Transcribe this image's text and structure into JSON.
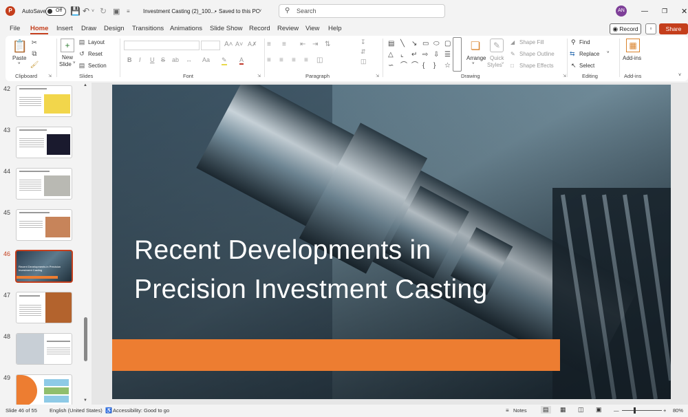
{
  "titlebar": {
    "app_logo": "P",
    "autosave_label": "AutoSave",
    "autosave_state": "Off",
    "doc_title": "Investment Casting (2)_100...",
    "save_state": "Saved to this PC",
    "search_placeholder": "Search",
    "avatar_initials": "AN"
  },
  "tabs": [
    "File",
    "Home",
    "Insert",
    "Draw",
    "Design",
    "Transitions",
    "Animations",
    "Slide Show",
    "Record",
    "Review",
    "View",
    "Help"
  ],
  "active_tab": "Home",
  "actions": {
    "record": "Record",
    "share": "Share"
  },
  "ribbon": {
    "clipboard": {
      "label": "Clipboard",
      "paste": "Paste"
    },
    "slides": {
      "label": "Slides",
      "new_slide": "New",
      "new_slide_2": "Slide",
      "layout": "Layout",
      "reset": "Reset",
      "section": "Section"
    },
    "font": {
      "label": "Font",
      "bold": "B",
      "italic": "I",
      "underline": "U",
      "strike": "S",
      "font_color": "A"
    },
    "paragraph": {
      "label": "Paragraph"
    },
    "drawing": {
      "label": "Drawing",
      "arrange": "Arrange",
      "quick_styles": "Quick",
      "quick_styles_2": "Styles",
      "shape_fill": "Shape Fill",
      "shape_outline": "Shape Outline",
      "shape_effects": "Shape Effects"
    },
    "editing": {
      "label": "Editing",
      "find": "Find",
      "replace": "Replace",
      "select": "Select"
    },
    "addins": {
      "label": "Add-ins",
      "button": "Add-ins"
    }
  },
  "slides_panel": {
    "numbers": [
      "42",
      "43",
      "44",
      "45",
      "46",
      "47",
      "48",
      "49"
    ],
    "active": "46",
    "thumb_46_text": "Recent Developments in Precision Investment Casting"
  },
  "slide": {
    "title_line1": "Recent Developments in",
    "title_line2": "Precision Investment Casting"
  },
  "statusbar": {
    "slide_info": "Slide 46 of 55",
    "language": "English (United States)",
    "accessibility": "Accessibility: Good to go",
    "notes": "Notes",
    "zoom": "80%"
  },
  "colors": {
    "accent": "#c43e1c",
    "orange": "#ed7d31",
    "slide_bg": "#2a4a5c"
  }
}
